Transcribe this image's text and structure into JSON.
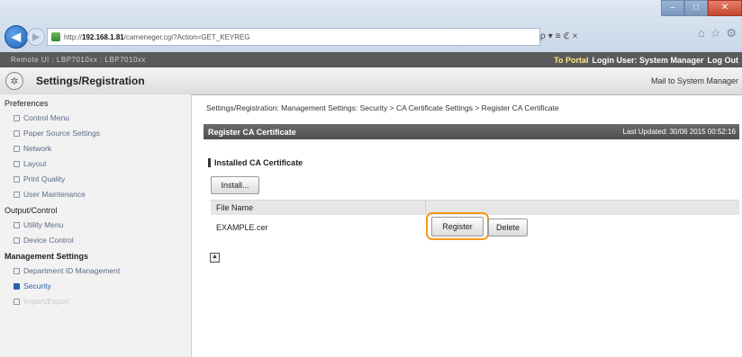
{
  "browser": {
    "address_prefix": "http://",
    "address_host": "192.168.1.81",
    "address_path": "/cameneger.cgi?Action=GET_KEYREG",
    "address_tools": [
      "ρ",
      "▾",
      "≡",
      "ℭ",
      "×"
    ],
    "window_buttons": [
      "–",
      "□",
      "✕"
    ],
    "right_icons": [
      "home-icon",
      "star-icon",
      "gear-icon"
    ]
  },
  "topbar": {
    "device_name": "Remote UI : LBP7010xx : LBP7010xx",
    "portal_link": "To Portal",
    "login_user": "Login User: System Manager",
    "logout": "Log Out"
  },
  "header": {
    "title": "Settings/Registration",
    "mail_link": "Mail to System Manager"
  },
  "sidebar": {
    "sections": [
      {
        "label": "Preferences",
        "bold": false,
        "items": [
          "Control Menu",
          "Paper Source Settings",
          "Network",
          "Layout",
          "Print Quality",
          "User Maintenance"
        ]
      },
      {
        "label": "Output/Control",
        "bold": false,
        "items": [
          "Utility Menu",
          "Device Control"
        ]
      },
      {
        "label": "Management Settings",
        "bold": true,
        "items": [
          "Department ID Management",
          "Security",
          "Import/Export"
        ]
      }
    ],
    "active_item": "Security"
  },
  "main": {
    "breadcrumb": "Settings/Registration: Management Settings: Security > CA Certificate Settings > Register CA Certificate",
    "panel_title": "Register CA Certificate",
    "last_updated": "Last Updated: 30/06 2015 00:52:16",
    "section_title": "Installed CA Certificate",
    "install_button": "Install...",
    "table": {
      "header": "File Name",
      "rows": [
        {
          "file_name": "EXAMPLE.cer",
          "register": "Register",
          "delete": "Delete"
        }
      ]
    },
    "to_top_icon": "▲"
  },
  "colors": {
    "highlight": "#f09a1a",
    "panel_header": "#5a5a5a",
    "active_link": "#2a5fae"
  }
}
